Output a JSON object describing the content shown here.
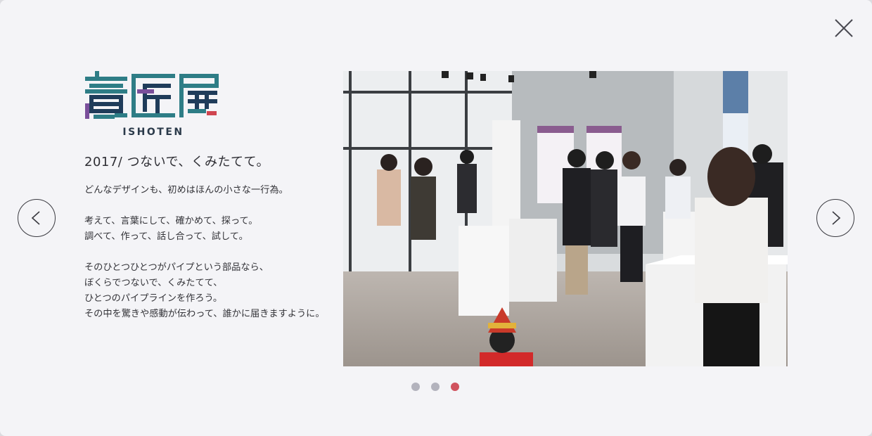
{
  "modal": {
    "close_icon": "close-icon",
    "prev_icon": "chevron-left-icon",
    "next_icon": "chevron-right-icon"
  },
  "logo": {
    "wordmark": "意匠展",
    "caption": "ISHOTEN",
    "colors": {
      "teal": "#2e7d86",
      "navy": "#1f3c5a",
      "purple": "#7a4f9b",
      "red": "#d04550"
    }
  },
  "content": {
    "headline": "2017/ つないで、くみたてて。",
    "paragraphs": [
      "どんなデザインも、初めはほんの小さな一行為。",
      "考えて、言葉にして、確かめて、探って。\n調べて、作って、話し合って、試して。",
      "そのひとつひとつがパイプという部品なら、\nぼくらでつないで、くみたてて、\nひとつのパイプラインを作ろう。\nその中を驚きや感動が伝わって、誰かに届きますように。"
    ]
  },
  "carousel": {
    "active_index": 2,
    "dots": [
      {
        "color": "#b3b3bd"
      },
      {
        "color": "#b3b3bd"
      },
      {
        "color": "#d0525e"
      }
    ]
  }
}
